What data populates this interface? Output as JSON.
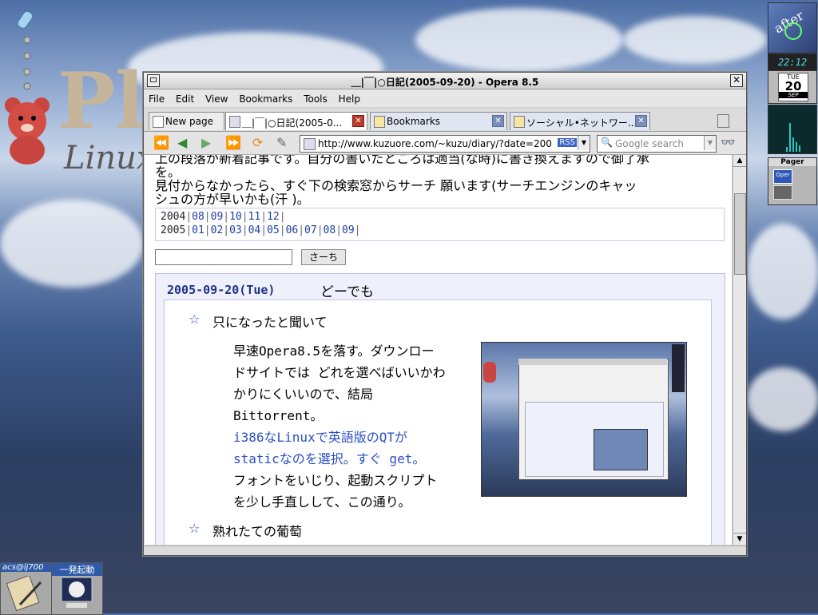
{
  "desktop": {
    "logo_text": "Pl",
    "logo_sub": "Linux",
    "dock": {
      "clock_time": "22:12",
      "calendar": {
        "weekday": "TUE",
        "day": "20",
        "month": "SEP"
      },
      "pager_label": "Pager",
      "pager_item": "Oper"
    },
    "taskbar": {
      "user_label": "acs@lj700",
      "launcher_label": "一発起動"
    }
  },
  "window": {
    "title": "＿|￣|○日記(2005-09-20) - Opera 8.5",
    "menu": [
      "File",
      "Edit",
      "View",
      "Bookmarks",
      "Tools",
      "Help"
    ],
    "tabs": [
      {
        "label": "New page",
        "active": false
      },
      {
        "label": "＿|￣|○日記(2005-0...",
        "active": true
      },
      {
        "label": "Bookmarks",
        "active": false
      },
      {
        "label": "ソーシャル•ネットワー...",
        "active": false
      }
    ],
    "address": {
      "url": "http://www.kuzuore.com/~kuzu/diary/?date=200",
      "rss": "RSS"
    },
    "search_placeholder": "Google search"
  },
  "page": {
    "intro_line1": "上の段落が新着記事です。自分の書いたところは適当(な時)に書き換えますので御了承",
    "intro_line1b": "を。",
    "intro_line2": "見付からなかったら、すぐ下の検索窓からサーチ 願います(サーチエンジンのキャッ",
    "intro_line3": "シュの方が早いかも(汗 )。",
    "archive": {
      "year1": "2004",
      "months1": [
        "08",
        "09",
        "10",
        "11",
        "12"
      ],
      "year2": "2005",
      "months2": [
        "01",
        "02",
        "03",
        "04",
        "05",
        "06",
        "07",
        "08",
        "09"
      ]
    },
    "search_button": "さーち",
    "day": {
      "date": "2005-09-20(Tue)",
      "title": "どーでも",
      "section1": {
        "heading": "只になったと聞いて",
        "lines": [
          "早速Opera8.5を落す。ダウンロー",
          "ドサイトでは どれを選べばいいかわ",
          "かりにくいいので、結局",
          "Bittorrent。",
          "i386なLinuxで英語版のQTが",
          "staticなのを選択。すぐ get。",
          "フォントをいじり、起動スクリプト",
          "を少し手直しして、この通り。"
        ]
      },
      "section2": {
        "heading": "熟れたての葡萄"
      }
    }
  },
  "colors": {
    "link": "#1f3fa3",
    "date": "#22338a",
    "tab_close": "#5a6e95"
  }
}
